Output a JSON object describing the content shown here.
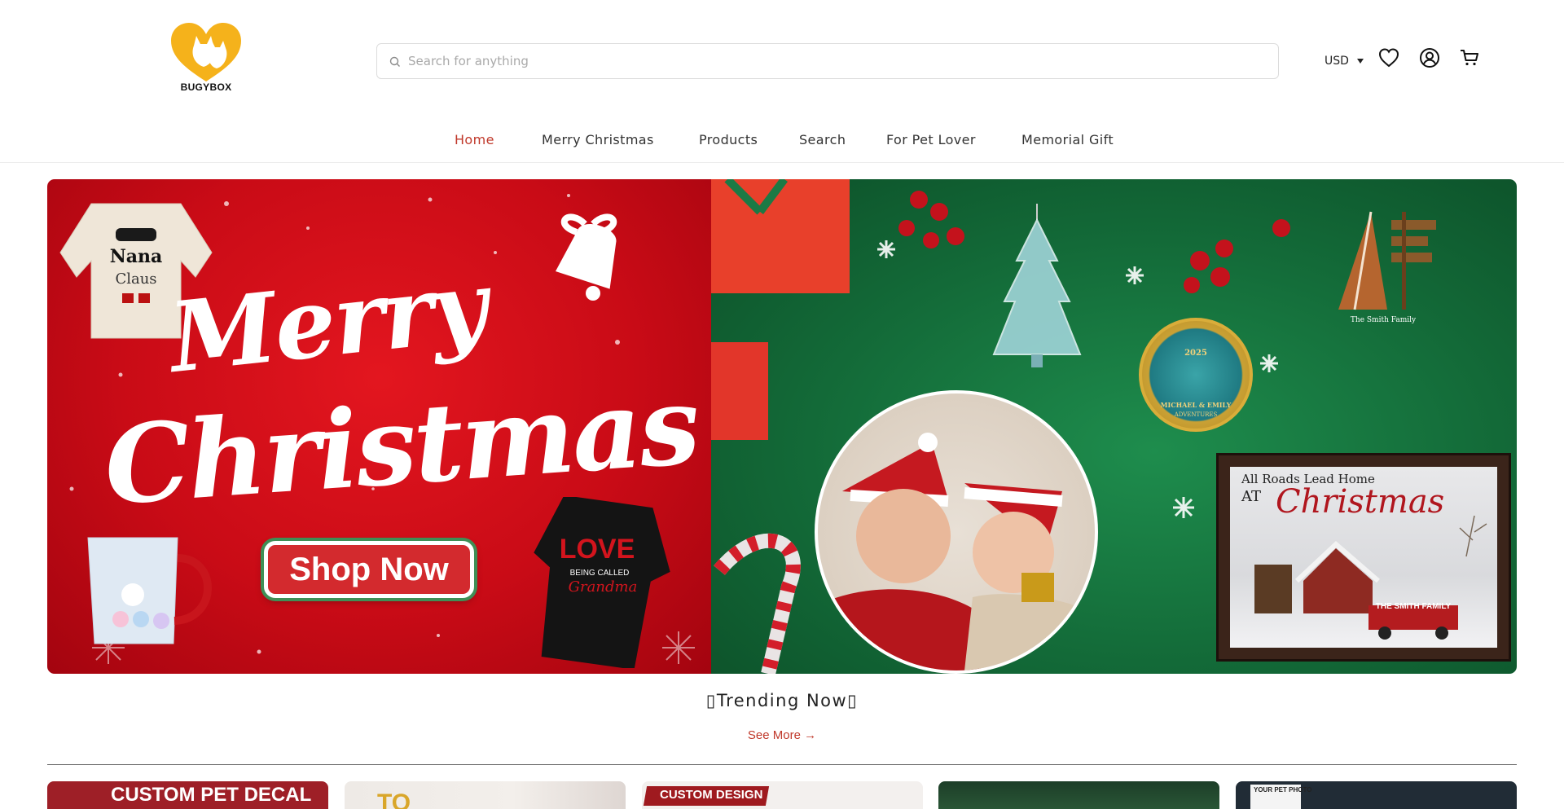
{
  "brand": {
    "name": "BUGYBOX",
    "logo_color": "#f5b21b"
  },
  "search": {
    "placeholder": "Search for anything",
    "value": ""
  },
  "header": {
    "currency": "USD",
    "icons": [
      "heart-icon",
      "user-icon",
      "cart-icon"
    ]
  },
  "nav": {
    "items": [
      {
        "label": "Home",
        "active": true
      },
      {
        "label": "Merry Christmas",
        "active": false
      },
      {
        "label": "Products",
        "active": false
      },
      {
        "label": "Search",
        "active": false
      },
      {
        "label": "For Pet Lover",
        "active": false
      },
      {
        "label": "Memorial Gift",
        "active": false
      }
    ]
  },
  "hero": {
    "merry": "Merry",
    "christmas": "Christmas",
    "shop_button": "Shop Now",
    "frame_title": "All Roads Lead Home",
    "frame_at": "AT",
    "frame_script": "Christmas",
    "frame_family": "THE SMITH FAMILY",
    "tree_family": "The Smith Family",
    "globe_text": "MICHAEL & EMILY",
    "globe_sub": "ADVENTURES",
    "globe_year": "2025",
    "sweater_title": "Nana",
    "sweater_sub": "Claus",
    "love": "LOVE",
    "love_sub": "BEING CALLED",
    "love_script": "Grandma"
  },
  "trending": {
    "title": "▯Trending Now▯",
    "see_more": "See More →"
  },
  "cards": [
    {
      "label": "CUSTOM PET DECAL",
      "bg": "#9e1f27"
    },
    {
      "label": "TO",
      "bg": "#efe8e4"
    },
    {
      "label": "CUSTOM DESIGN",
      "bg": "#f3f0ee"
    },
    {
      "label": "",
      "bg": "#1d3e28"
    },
    {
      "label": "YOUR PET PHOTO",
      "bg": "#212c36"
    }
  ],
  "colors": {
    "accent": "#c0392b",
    "hero_red": "#d11a22",
    "hero_green": "#16733d"
  }
}
